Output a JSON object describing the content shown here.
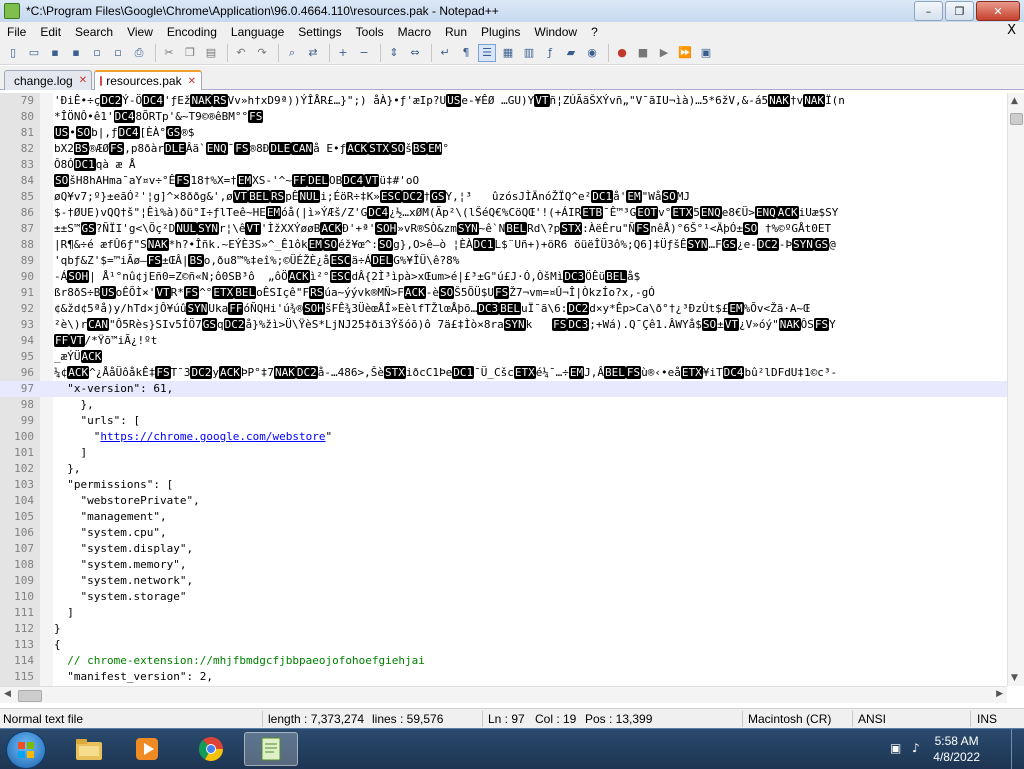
{
  "window": {
    "title": "*C:\\Program Files\\Google\\Chrome\\Application\\96.0.4664.110\\resources.pak - Notepad++",
    "minimize": "–",
    "maximize": "❐",
    "close": "✕"
  },
  "menu": {
    "items": [
      "File",
      "Edit",
      "Search",
      "View",
      "Encoding",
      "Language",
      "Settings",
      "Tools",
      "Macro",
      "Run",
      "Plugins",
      "Window",
      "?"
    ],
    "close": "X"
  },
  "toolbar": {
    "icons": [
      "new-file-icon",
      "open-file-icon",
      "save-icon",
      "save-all-icon",
      "close-icon",
      "close-all-icon",
      "print-icon",
      "cut-icon",
      "copy-icon",
      "paste-icon",
      "undo-icon",
      "redo-icon",
      "find-icon",
      "replace-icon",
      "zoom-in-icon",
      "zoom-out-icon",
      "sync-v-icon",
      "sync-h-icon",
      "word-wrap-icon",
      "show-all-chars-icon",
      "indent-guide-icon",
      "udl-icon",
      "doc-map-icon",
      "function-list-icon",
      "folder-workspace-icon",
      "monitoring-icon",
      "record-macro-icon",
      "stop-macro-icon",
      "play-macro-icon",
      "run-macro-multiple-icon",
      "save-macro-icon"
    ]
  },
  "tabs": [
    {
      "label": "change.log",
      "color": "#4a90d9"
    },
    {
      "label": "resources.pak",
      "color": "#d94a4a"
    }
  ],
  "editor": {
    "current_line": 97,
    "lines": [
      {
        "n": "79",
        "raw": "'ĐiÊ•÷çDC2Ý-ÖDC4'ƒEžNAKRSVv»h†xD9ª))ÝÎÅR£…}\";) åÀ}•ƒ'æIp?UUSe-¥ÊØ …GU)YVTñ¦ZÚÃãŠXÝvñ„\"V¯ãIU¬ìà)…5*6žV,&-á5NAK†vNAKÏ(n"
      },
      {
        "n": "80",
        "raw": "*ÎÖNÔ•ê1'DC48ÕRTp'&~T9©®êBM°°FS"
      },
      {
        "n": "81",
        "raw": "US•SOb|,ƒDC4[ÈÀ°GS®$"
      },
      {
        "n": "82",
        "raw": "bX2BS®ÆØFS,p8ðàrDLEÂä`ENQ¯FS®8ÐDLECANå E•ƒACKSTXSOšBSEM°"
      },
      {
        "n": "83",
        "raw": "Ô8ÓDC1qà æ Å"
      },
      {
        "n": "84",
        "raw": "SOšH8hAHma¯aY¤v÷°ÊFS18†%X=†EMXS-'^~FFDELOBDC4VTü‡#'oO"
      },
      {
        "n": "85",
        "raw": "øQ¥v7;º}±eãÓ²'¦g]^×8ððg&',øVTBELRSpÊNULi;ÉöR÷‡K»ESCDC2†GSY,¦³   ûzósJÌÄnóŽÏQ^e²DC1å'EM\"WåSOMJ"
      },
      {
        "n": "86",
        "raw": "$-†ØUE)vQQ†š\"¦Êì%à)ðü°I÷ƒlTeê~HEEMóå(|ì»ÝÆš/Z'GDC4¿½…xØM(Ãp²\\(lŠéQ€%CöQŒ'!(+ÁIRETB¯Ê™³GEOTv°ETX5ENQe8€Ü>ENQACKiUæ$SY"
      },
      {
        "n": "87",
        "raw": "±±S™GS?ÑÏI'g<\\Öç²DNULSYNr¦\\êVT'ÌžXXÝøøBACKÐ'+ª'SOH»vR®SÒ&zmSYN~ê`NBELRd\\?pSTX:ÀëÊru\"ÑFSnêÅ)°6Š°¹<ÄþÓ±SO †%©ºGÅt0ET"
      },
      {
        "n": "88",
        "raw": "|R¶&÷é æfÛ6ƒ\"SNAK*h?•Îñk.~EÝÈ3S»^_Ê1ôkEMSOéž¥œ^:SOg},O>ê—ò ¦ÈÀDC1L$¨Uñ+)+öR6 öüëÎÜ3ô%;Q6]‡ÜƒšÊSYN…FGS¿e-DC2-ÞSYNGS@"
      },
      {
        "n": "89",
        "raw": "'qbƒ&Z'$=™iÃø—FS±ŒÂ|BSo,ðu8™%‡eî%;©ÜÉŽÈ¿åESCä÷ÁDELG%¥ÎÜ\\ê?8%"
      },
      {
        "n": "90",
        "raw": "-ÁSOH| Å¹°nû¢jEñ0=Z©ñ«N;ô0SB³ô  „ôÖACKì²°ESCdÂ{2Ì³ìpà>xŒum>é|£³±G\"ú£J·Ó,ÒšMìDC3ÖÊüBELå$"
      },
      {
        "n": "91",
        "raw": "ßr8ðS÷BUSoÊÕÌ×'VTR*FS^°ETXBELoÊSIçê\"FRSúa~ýývk®MÑ>FACK-èSOŠ5ÕÜ$UFSŽ7¬vm=¤Û¬Î|ÒkzÍo?x,-gÓ"
      },
      {
        "n": "92",
        "raw": "¢&žd¢5ªå)y/hTd×jÔ¥úûSYNUkaFFóÑQHi'ú¾®SOHšFÊ¾3ÜèœÅÎ»EèlfTŽlœÅþõ…DC3BELuÏ¯ã\\6:DC2d×y*Êp>Ca\\ð°†¿³ÐzÙt$£EM%Õv<Žã·A~Œ"
      },
      {
        "n": "93",
        "raw": "²è\\)rCAN\"Ô5Rès}SIv5ÍÖ7GSqDC2å}%žì>Ü\\ŸèS*LjNJ25‡ði3Ýšóõ)ô 7ä£‡Ìò×8raSYNk   FSDC3;+Wá).Q¯Çê1.ÂWYå$SO±VT¿V»óý\"NAKÔSFSY"
      },
      {
        "n": "94",
        "raw": "FFVT/*Ÿõ™iÃ¿!ºt"
      },
      {
        "n": "95",
        "raw": "_æÝÜACK"
      },
      {
        "n": "96",
        "raw": "¼¢ACK^¿ÅåÜôåkÊ‡FST¯3DC2yACKÞP°‡7NAKDC2å-…486>,ŠèSTXiðcC1ÞeDC1¯Ü_CšcETXé¼¯…÷EMJ,ÂBELFSù®‹•eåETX¥iTDC4bû²lDFdU‡1©c³-"
      },
      {
        "n": "97",
        "raw": "  \"x-version\": 61,"
      },
      {
        "n": "98",
        "raw": "    },"
      },
      {
        "n": "99",
        "raw": "    \"urls\": ["
      },
      {
        "n": "100",
        "raw": "      \"https://chrome.google.com/webstore\""
      },
      {
        "n": "101",
        "raw": "    ]"
      },
      {
        "n": "102",
        "raw": "  },"
      },
      {
        "n": "103",
        "raw": "  \"permissions\": ["
      },
      {
        "n": "104",
        "raw": "    \"webstorePrivate\","
      },
      {
        "n": "105",
        "raw": "    \"management\","
      },
      {
        "n": "106",
        "raw": "    \"system.cpu\","
      },
      {
        "n": "107",
        "raw": "    \"system.display\","
      },
      {
        "n": "108",
        "raw": "    \"system.memory\","
      },
      {
        "n": "109",
        "raw": "    \"system.network\","
      },
      {
        "n": "110",
        "raw": "    \"system.storage\""
      },
      {
        "n": "111",
        "raw": "  ]"
      },
      {
        "n": "112",
        "raw": "}"
      },
      {
        "n": "113",
        "raw": "{"
      },
      {
        "n": "114",
        "raw": "  // chrome-extension://mhjfbmdgcfjbbpaeojofohoefgiehjai"
      },
      {
        "n": "115",
        "raw": "  \"manifest_version\": 2,"
      }
    ]
  },
  "status": {
    "type": "Normal text file",
    "length": "length : 7,373,274",
    "lines": "lines : 59,576",
    "ln": "Ln : 97",
    "col": "Col : 19",
    "pos": "Pos : 13,399",
    "eol": "Macintosh (CR)",
    "encoding": "ANSI",
    "mode": "INS"
  },
  "taskbar": {
    "time": "5:58 AM",
    "date": "4/8/2022",
    "apps": [
      "windows-explorer-icon",
      "media-player-icon",
      "chrome-icon",
      "notepadpp-icon"
    ]
  }
}
